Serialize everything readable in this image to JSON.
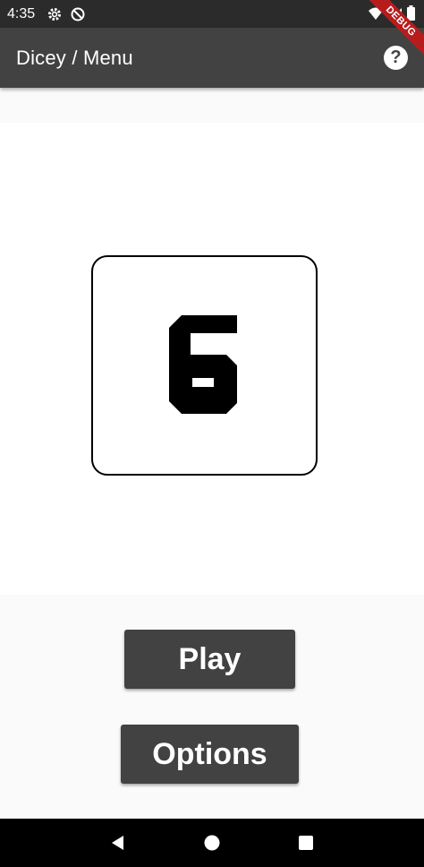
{
  "status_bar": {
    "time": "4:35",
    "icons": [
      "gear-icon",
      "do-not-disturb-icon",
      "wifi-icon",
      "signal-icon",
      "battery-icon"
    ]
  },
  "app_bar": {
    "title": "Dicey / Menu",
    "help_label": "?"
  },
  "debug_banner": {
    "label": "DEBUG"
  },
  "die": {
    "value": "6"
  },
  "menu": {
    "play_label": "Play",
    "options_label": "Options"
  },
  "colors": {
    "app_bar": "#424242",
    "status_bar": "#2b2b2b",
    "button": "#424242",
    "debug_banner": "#b71c1c"
  },
  "nav_bar": {
    "icons": [
      "back-icon",
      "home-icon",
      "recents-icon"
    ]
  }
}
